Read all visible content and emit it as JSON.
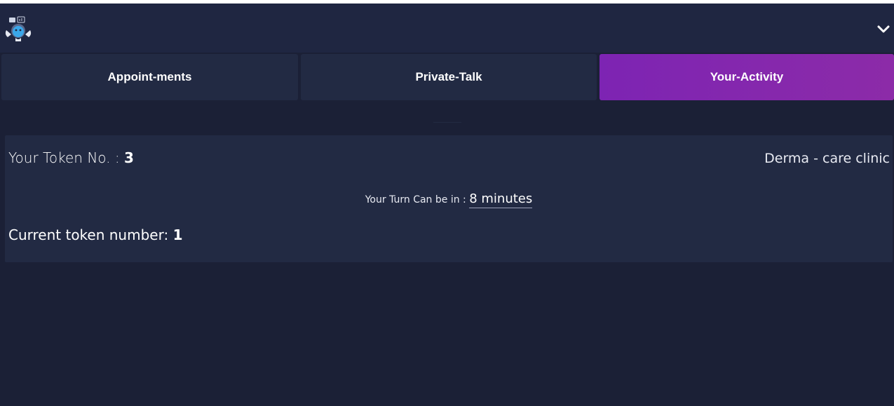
{
  "navbar": {
    "logo_icon": "doctor-avatar-icon",
    "toggle_icon": "chevron-down-icon"
  },
  "tabs": [
    {
      "label": "Appoint-ments",
      "active": false
    },
    {
      "label": "Private-Talk",
      "active": false
    },
    {
      "label": "Your-Activity",
      "active": true
    }
  ],
  "activity": {
    "token_label": "Your Token No. : ",
    "token_value": "3",
    "clinic_name": "Derma - care clinic",
    "turn_label": "Your Turn Can be in : ",
    "turn_value": "8 minutes",
    "current_label": "Current token number: ",
    "current_value": "1"
  },
  "colors": {
    "background": "#1b2036",
    "surface": "#222a43",
    "accent": "#7d24b3"
  }
}
